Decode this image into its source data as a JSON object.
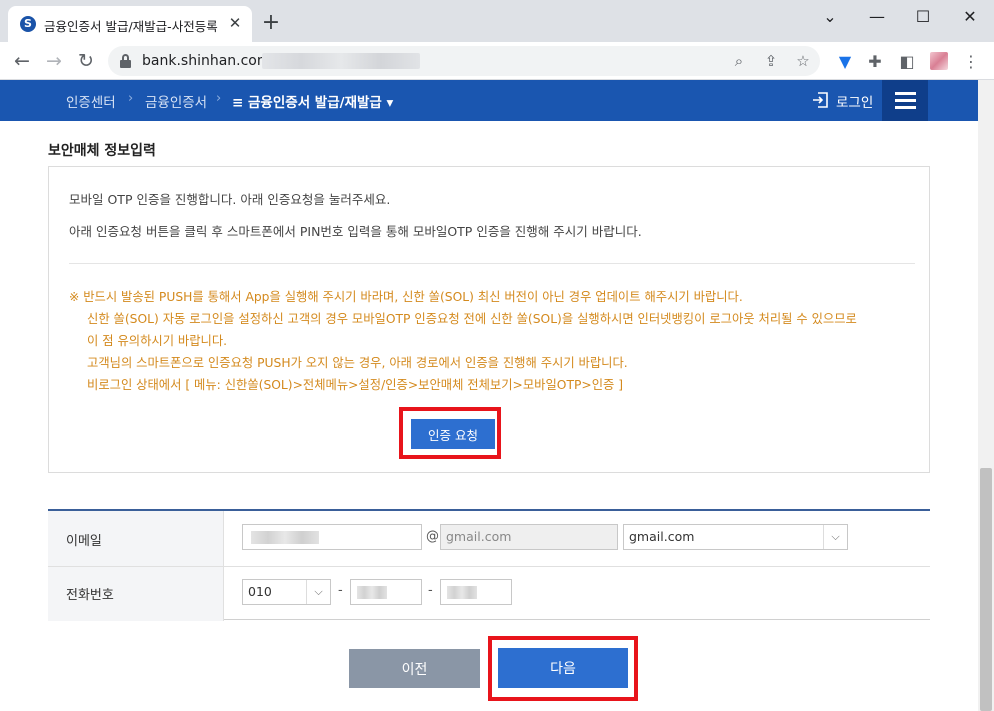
{
  "browser": {
    "tab_title": "금융인증서 발급/재발급-사전등록",
    "favicon_letter": "S",
    "new_tab": "+",
    "url": "bank.shinhan.com,"
  },
  "header": {
    "breadcrumbs": [
      "인증센터",
      "금융인증서"
    ],
    "current": "≡ 금융인증서 발급/재발급 ▾",
    "login_label": "로그인"
  },
  "section": {
    "title": "보안매체 정보입력"
  },
  "info": {
    "line1": "모바일 OTP 인증을 진행합니다. 아래 인증요청을 눌러주세요.",
    "line2": "아래 인증요청 버튼을 클릭 후 스마트폰에서 PIN번호 입력을 통해 모바일OTP 인증을 진행해 주시기 바랍니다.",
    "notice": [
      "※ 반드시 발송된 PUSH를 통해서 App을 실행해 주시기 바라며, 신한 쏠(SOL) 최신 버전이 아닌 경우 업데이트 해주시기 바랍니다.",
      "신한 쏠(SOL) 자동 로그인을 설정하신 고객의 경우 모바일OTP 인증요청 전에 신한 쏠(SOL)을 실행하시면 인터넷뱅킹이 로그아웃 처리될 수 있으므로",
      "이 점 유의하시기 바랍니다.",
      "고객님의 스마트폰으로 인증요청 PUSH가 오지 않는 경우, 아래 경로에서 인증을 진행해 주시기 바랍니다.",
      "비로그인 상태에서 [ 메뉴: 신한쏠(SOL)>전체메뉴>설정/인증>보안매체 전체보기>모바일OTP>인증 ]"
    ],
    "auth_button": "인증 요청"
  },
  "form": {
    "email_label": "이메일",
    "email_at": "@",
    "email_domain_placeholder": "gmail.com",
    "email_domain_select": "gmail.com",
    "phone_label": "전화번호",
    "phone_prefix": "010",
    "phone_dash": "-"
  },
  "buttons": {
    "prev": "이전",
    "next": "다음"
  },
  "colors": {
    "header_bg": "#1a56b0",
    "accent_blue": "#2d6fd0",
    "notice_orange": "#d48a1e",
    "highlight_red": "#e8141b"
  }
}
